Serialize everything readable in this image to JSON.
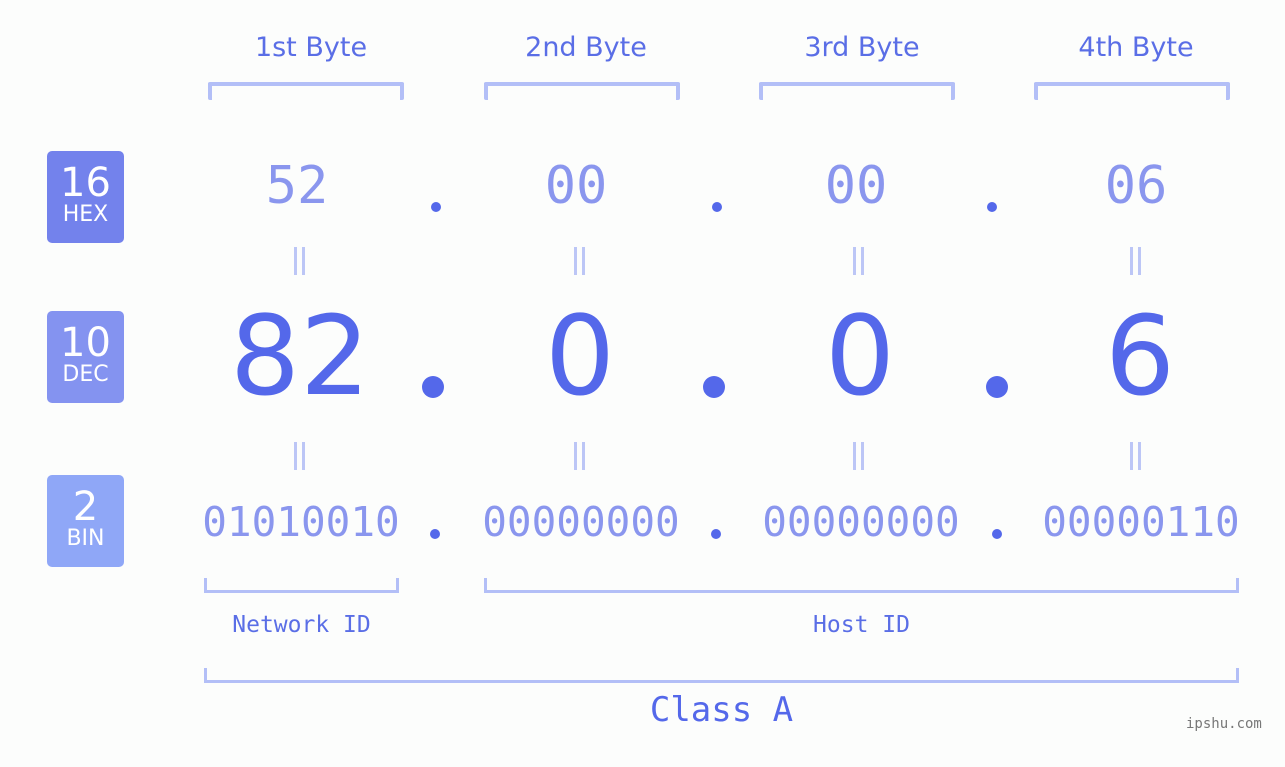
{
  "bytes": {
    "headers": [
      "1st Byte",
      "2nd Byte",
      "3rd Byte",
      "4th Byte"
    ]
  },
  "badges": {
    "hex": {
      "num": "16",
      "label": "HEX",
      "color": "#7382ec"
    },
    "dec": {
      "num": "10",
      "label": "DEC",
      "color": "#8493f0"
    },
    "bin": {
      "num": "2",
      "label": "BIN",
      "color": "#8fa7f7"
    }
  },
  "hex": [
    "52",
    "00",
    "00",
    "06"
  ],
  "dec": [
    "82",
    "0",
    "0",
    "6"
  ],
  "bin": [
    "01010010",
    "00000000",
    "00000000",
    "00000110"
  ],
  "ids": {
    "network": "Network ID",
    "host": "Host ID"
  },
  "class_label": "Class A",
  "watermark": "ipshu.com",
  "colors": {
    "accent": "#5468ea",
    "light": "#8a96ee",
    "bracket": "#b3bff7"
  }
}
